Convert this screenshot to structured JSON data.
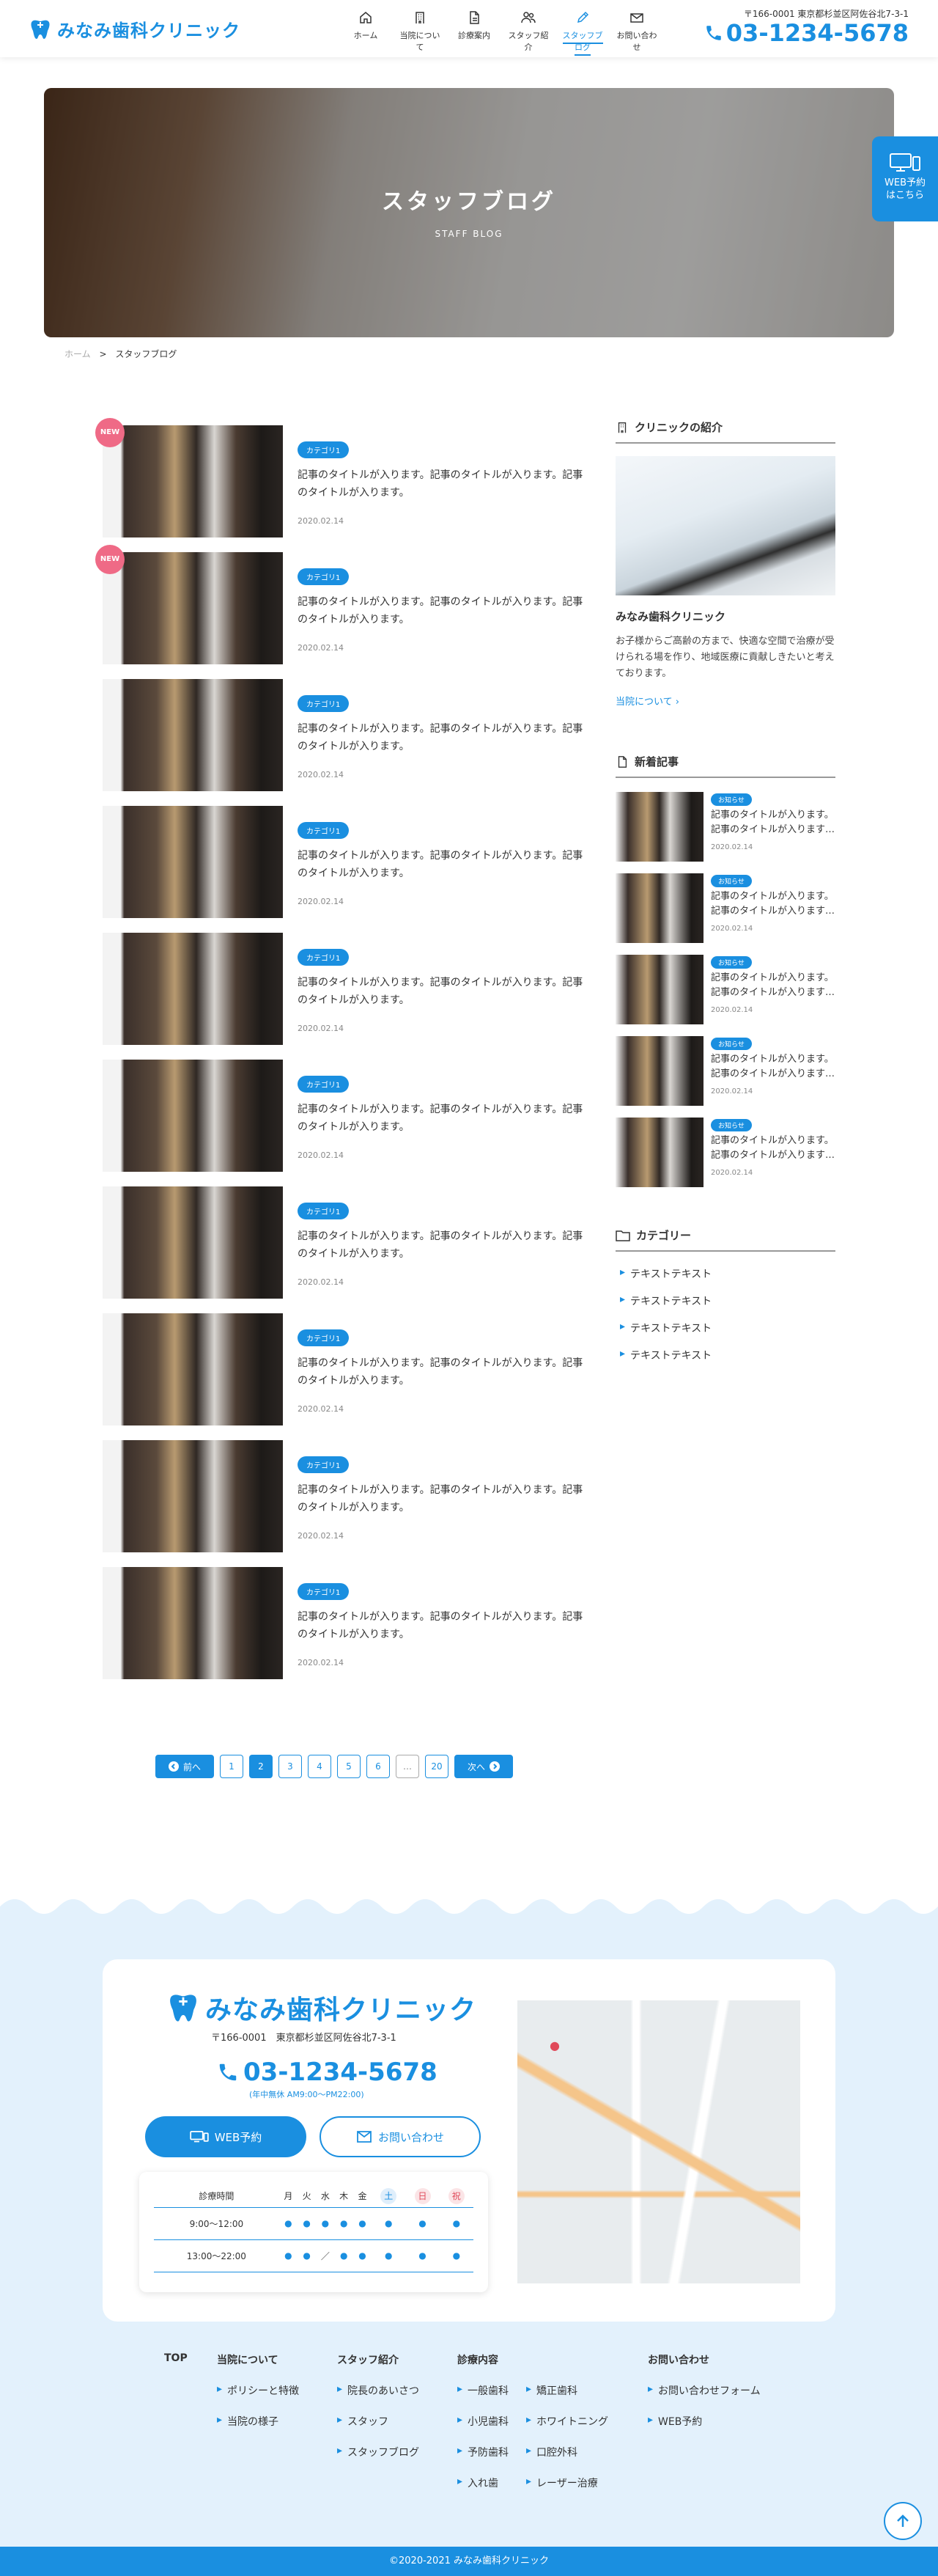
{
  "header": {
    "logo": "みなみ歯科クリニック",
    "nav": [
      {
        "label": "ホーム",
        "icon": "home-icon"
      },
      {
        "label": "当院について",
        "icon": "building-icon"
      },
      {
        "label": "診療案内",
        "icon": "document-icon"
      },
      {
        "label": "スタッフ紹介",
        "icon": "people-icon"
      },
      {
        "label": "スタッフブログ",
        "icon": "pen-icon",
        "active": true
      },
      {
        "label": "お問い合わせ",
        "icon": "mail-icon"
      }
    ],
    "address": "〒166-0001 東京都杉並区阿佐谷北7-3-1",
    "tel": "03-1234-5678"
  },
  "hero": {
    "title": "スタッフブログ",
    "subtitle": "STAFF BLOG"
  },
  "web_reservation": {
    "line1": "WEB予約",
    "line2": "はこちら"
  },
  "breadcrumb": {
    "home": "ホーム",
    "sep": ">",
    "current": "スタッフブログ"
  },
  "posts": [
    {
      "new": "NEW",
      "category": "カテゴリ1",
      "title": "記事のタイトルが入ります。記事のタイトルが入ります。記事のタイトルが入ります。",
      "date": "2020.02.14"
    },
    {
      "new": "NEW",
      "category": "カテゴリ1",
      "title": "記事のタイトルが入ります。記事のタイトルが入ります。記事のタイトルが入ります。",
      "date": "2020.02.14"
    },
    {
      "category": "カテゴリ1",
      "title": "記事のタイトルが入ります。記事のタイトルが入ります。記事のタイトルが入ります。",
      "date": "2020.02.14"
    },
    {
      "category": "カテゴリ1",
      "title": "記事のタイトルが入ります。記事のタイトルが入ります。記事のタイトルが入ります。",
      "date": "2020.02.14"
    },
    {
      "category": "カテゴリ1",
      "title": "記事のタイトルが入ります。記事のタイトルが入ります。記事のタイトルが入ります。",
      "date": "2020.02.14"
    },
    {
      "category": "カテゴリ1",
      "title": "記事のタイトルが入ります。記事のタイトルが入ります。記事のタイトルが入ります。",
      "date": "2020.02.14"
    },
    {
      "category": "カテゴリ1",
      "title": "記事のタイトルが入ります。記事のタイトルが入ります。記事のタイトルが入ります。",
      "date": "2020.02.14"
    },
    {
      "category": "カテゴリ1",
      "title": "記事のタイトルが入ります。記事のタイトルが入ります。記事のタイトルが入ります。",
      "date": "2020.02.14"
    },
    {
      "category": "カテゴリ1",
      "title": "記事のタイトルが入ります。記事のタイトルが入ります。記事のタイトルが入ります。",
      "date": "2020.02.14"
    },
    {
      "category": "カテゴリ1",
      "title": "記事のタイトルが入ります。記事のタイトルが入ります。記事のタイトルが入ります。",
      "date": "2020.02.14"
    }
  ],
  "pagination": {
    "prev": "前へ",
    "pages": [
      "1",
      "2",
      "3",
      "4",
      "5",
      "6",
      "…",
      "20"
    ],
    "current": "2",
    "next": "次へ"
  },
  "sidebar": {
    "clinic": {
      "heading": "クリニックの紹介",
      "name": "みなみ歯科クリニック",
      "desc": "お子様からご高齢の方まで、快適な空間で治療が受けられる場を作り、地域医療に貢献しきたいと考えております。",
      "more": "当院について"
    },
    "news": {
      "heading": "新着記事",
      "items": [
        {
          "category": "お知らせ",
          "title": "記事のタイトルが入ります。記事のタイトルが入ります…",
          "date": "2020.02.14"
        },
        {
          "category": "お知らせ",
          "title": "記事のタイトルが入ります。記事のタイトルが入ります…",
          "date": "2020.02.14"
        },
        {
          "category": "お知らせ",
          "title": "記事のタイトルが入ります。記事のタイトルが入ります…",
          "date": "2020.02.14"
        },
        {
          "category": "お知らせ",
          "title": "記事のタイトルが入ります。記事のタイトルが入ります…",
          "date": "2020.02.14"
        },
        {
          "category": "お知らせ",
          "title": "記事のタイトルが入ります。記事のタイトルが入ります…",
          "date": "2020.02.14"
        }
      ]
    },
    "categories": {
      "heading": "カテゴリー",
      "items": [
        "テキストテキスト",
        "テキストテキスト",
        "テキストテキスト",
        "テキストテキスト"
      ]
    }
  },
  "footer": {
    "logo": "みなみ歯科クリニック",
    "address": "〒166-0001　東京都杉並区阿佐谷北7-3-1",
    "tel": "03-1234-5678",
    "hours_note": "(年中無休 AM9:00〜PM22:00)",
    "web_button": "WEB予約",
    "contact_button": "お問い合わせ",
    "schedule": {
      "header": [
        "診療時間",
        "月",
        "火",
        "水",
        "木",
        "金",
        "土",
        "日",
        "祝"
      ],
      "rows": [
        {
          "time": "9:00〜12:00",
          "cells": [
            "●",
            "●",
            "●",
            "●",
            "●",
            "●",
            "●",
            "●"
          ]
        },
        {
          "time": "13:00〜22:00",
          "cells": [
            "●",
            "●",
            "／",
            "●",
            "●",
            "●",
            "●",
            "●"
          ]
        }
      ]
    },
    "nav": {
      "top": "TOP",
      "about": {
        "title": "当院について",
        "links": [
          "ポリシーと特徴",
          "当院の様子"
        ]
      },
      "staff": {
        "title": "スタッフ紹介",
        "links": [
          "院長のあいさつ",
          "スタッフ",
          "スタッフブログ"
        ]
      },
      "treatment": {
        "title": "診療内容",
        "links": [
          "一般歯科",
          "小児歯科",
          "予防歯科",
          "入れ歯",
          "矯正歯科",
          "ホワイトニング",
          "口腔外科",
          "レーザー治療"
        ]
      },
      "contact": {
        "title": "お問い合わせ",
        "links": [
          "お問い合わせフォーム",
          "WEB予約"
        ]
      }
    },
    "copyright": "©2020-2021 みなみ歯科クリニック"
  },
  "colors": {
    "accent": "#1a8fe0",
    "new_badge": "#ef6a86",
    "footer_bg": "#e3f1fc"
  }
}
